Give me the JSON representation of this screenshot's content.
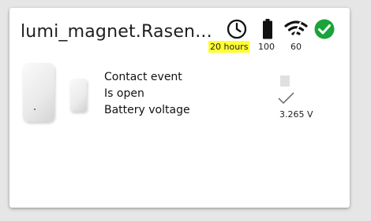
{
  "card": {
    "title": "lumi_magnet.Rasen...",
    "status": {
      "last_seen_icon": "clock-icon",
      "last_seen": "20 hours",
      "battery_icon": "battery-icon",
      "battery": "100",
      "signal_icon": "wifi-signal-icon",
      "signal": "60",
      "online_icon": "check-circle-icon",
      "online_color": "#1aa33a",
      "highlight_color": "#ffff33"
    },
    "rows": [
      {
        "label": "Contact event"
      },
      {
        "label": "Is open"
      },
      {
        "label": "Battery voltage",
        "value": "3.265 V"
      }
    ]
  }
}
